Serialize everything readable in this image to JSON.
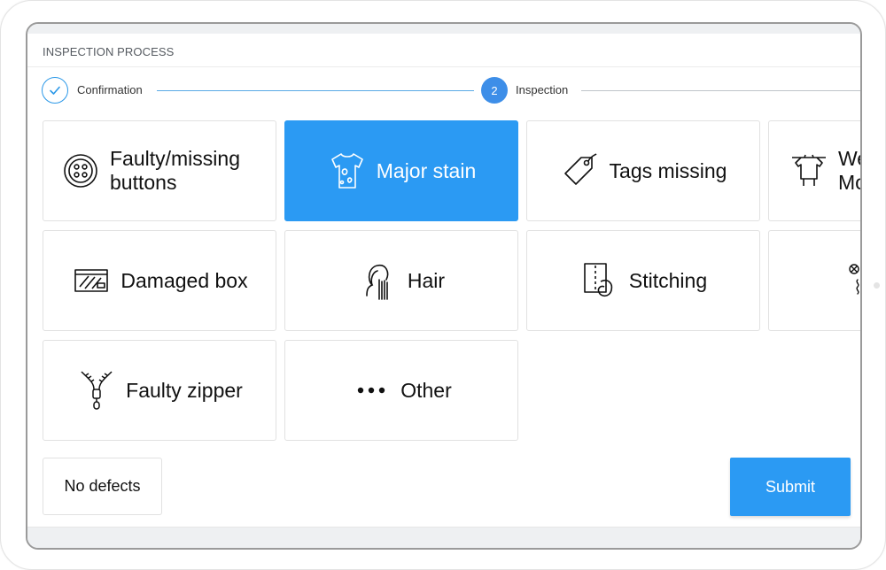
{
  "process": {
    "title": "INSPECTION PROCESS"
  },
  "stepper": {
    "steps": [
      {
        "label": "Confirmation",
        "state": "done"
      },
      {
        "number": "2",
        "label": "Inspection",
        "state": "active"
      }
    ]
  },
  "defects": [
    {
      "label": "Faulty/missing buttons",
      "icon": "button-icon",
      "selected": false
    },
    {
      "label": "Major stain",
      "icon": "stained-shirt-icon",
      "selected": true
    },
    {
      "label": "Tags missing",
      "icon": "tag-icon",
      "selected": false
    },
    {
      "label": "We Mo",
      "icon": "clothesline-icon",
      "selected": false
    },
    {
      "label": "Damaged box",
      "icon": "damaged-box-icon",
      "selected": false
    },
    {
      "label": "Hair",
      "icon": "hair-icon",
      "selected": false
    },
    {
      "label": "Stitching",
      "icon": "stitching-icon",
      "selected": false
    },
    {
      "label": "",
      "icon": "odor-icon",
      "selected": false
    },
    {
      "label": "Faulty zipper",
      "icon": "zipper-icon",
      "selected": false
    },
    {
      "label": "Other",
      "icon": "more-dots-icon",
      "selected": false
    }
  ],
  "actions": {
    "no_defects_label": "No defects",
    "submit_label": "Submit"
  },
  "colors": {
    "accent": "#2b9af3",
    "step_active": "#3d8ee8",
    "border": "#e1e1e1"
  }
}
